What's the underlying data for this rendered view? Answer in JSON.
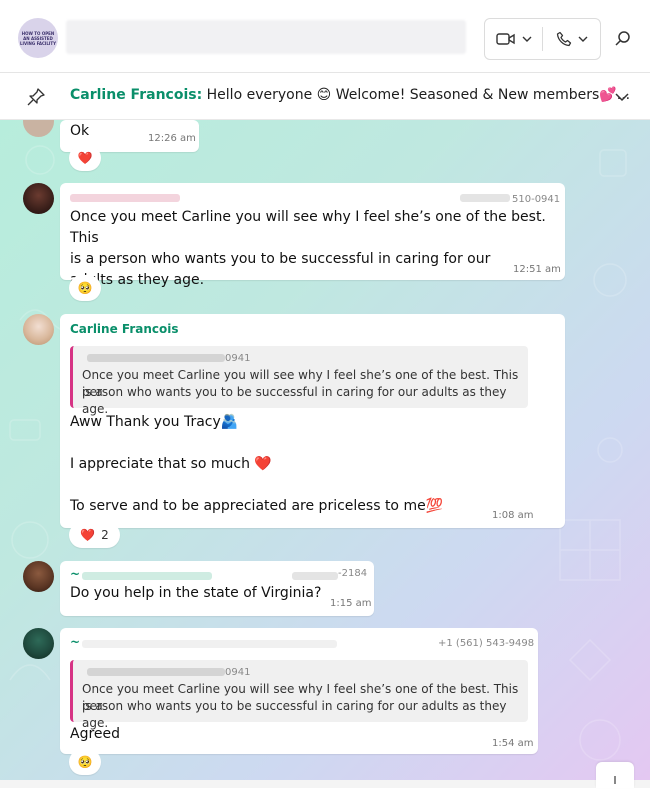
{
  "header": {
    "group_avatar_text": "HOW TO OPEN AN ASSISTED LIVING FACILITY"
  },
  "pinned": {
    "sender": "Carline Francois:",
    "text": "Hello everyone 😊  Welcome! Seasoned & New members💕..."
  },
  "messages": [
    {
      "text": "Ok",
      "time": "12:26 am",
      "reaction": "❤️"
    },
    {
      "phone": "510-0941",
      "text_lines": [
        "Once you meet Carline you will see why I feel she’s one of the best. This",
        "is a person who wants you to be successful in caring for our",
        "adults as they age."
      ],
      "time": "12:51 am",
      "reaction": "🥺"
    },
    {
      "sender": "Carline Francois",
      "quote_phone": "0941",
      "quote_lines": [
        "Once you meet Carline you will see why I feel she’s one of the best. This is a",
        "person who wants you to be successful in caring for our adults as they age."
      ],
      "line1": "Aww Thank you Tracy🫂",
      "line2": "I appreciate that so much ❤️",
      "line3": "To serve and to be appreciated are priceless to me💯",
      "time": "1:08 am",
      "reaction": "❤️",
      "reaction_count": "2"
    },
    {
      "sender_prefix": "~",
      "phone": "-2184",
      "text": "Do you help in the state of Virginia?",
      "time": "1:15 am"
    },
    {
      "sender_prefix": "~",
      "phone": "+1 (561) 543-9498",
      "quote_phone": "0941",
      "quote_lines": [
        "Once you meet Carline you will see why I feel she’s one of the best. This is a",
        "person who wants you to be successful in caring for our adults as they age."
      ],
      "text": "Agreed",
      "time": "1:54 am",
      "reaction": "🥺"
    }
  ],
  "colors": {
    "accent_green": "#0a8f6a",
    "quote_bar": "#d63384"
  }
}
